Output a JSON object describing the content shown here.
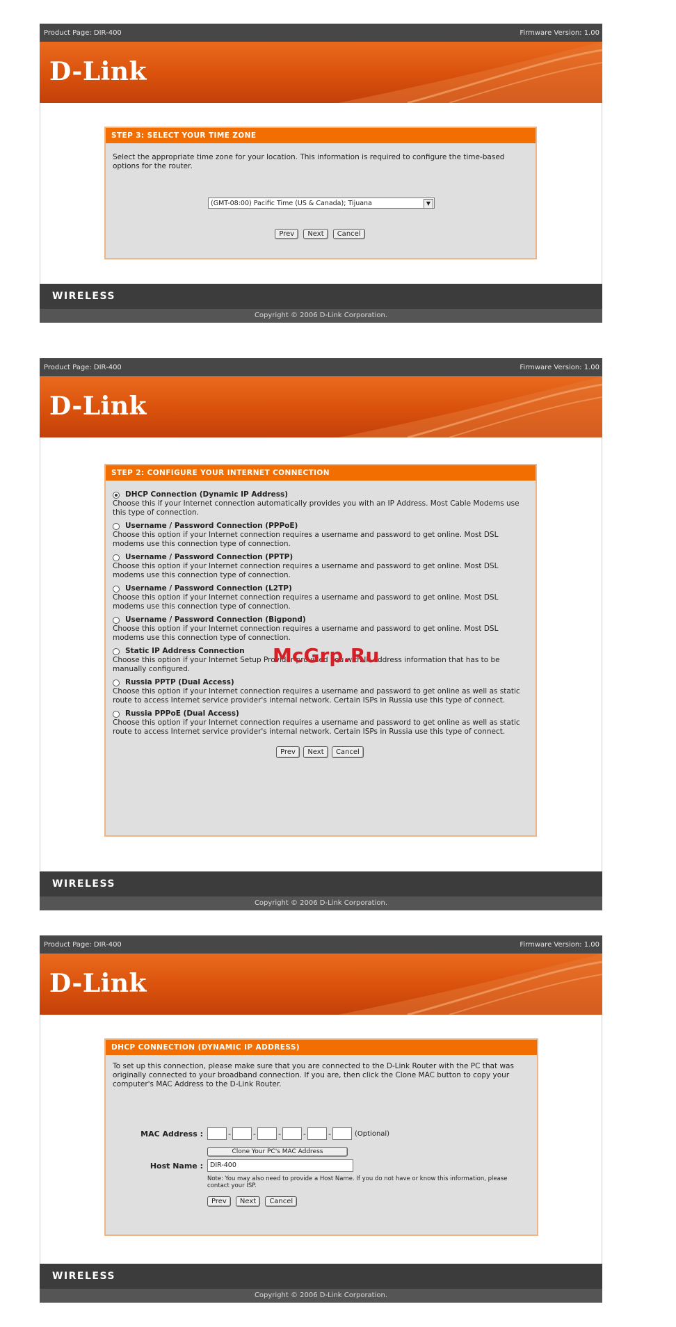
{
  "header": {
    "product": "Product Page: DIR-400",
    "firmware": "Firmware Version: 1.00",
    "logo": "D-Link"
  },
  "footer": {
    "wireless": "WIRELESS",
    "copyright": "Copyright © 2006 D-Link Corporation."
  },
  "colors": {
    "orange": "#f26e00",
    "dark": "#3c3c3c",
    "panel": "#dfdfdf"
  },
  "screen1": {
    "heading": "STEP 3: SELECT YOUR TIME ZONE",
    "description": "Select the appropriate time zone for your location. This information is required to configure the time-based options for the router.",
    "timezone": "(GMT-08:00) Pacific Time (US & Canada); Tijuana",
    "buttons": {
      "prev": "Prev",
      "next": "Next",
      "cancel": "Cancel"
    }
  },
  "screen2": {
    "heading": "STEP 2: CONFIGURE YOUR INTERNET CONNECTION",
    "options": [
      {
        "title": "DHCP Connection (Dynamic IP Address)",
        "desc": "Choose this if your Internet connection automatically provides you with an IP Address. Most Cable Modems use this type of connection."
      },
      {
        "title": "Username / Password Connection (PPPoE)",
        "desc": "Choose this option if your Internet connection requires a username and password to get online. Most DSL modems use this connection type of connection."
      },
      {
        "title": "Username / Password Connection (PPTP)",
        "desc": "Choose this option if your Internet connection requires a username and password to get online. Most DSL modems use this connection type of connection."
      },
      {
        "title": "Username / Password Connection (L2TP)",
        "desc": "Choose this option if your Internet connection requires a username and password to get online. Most DSL modems use this connection type of connection."
      },
      {
        "title": "Username / Password Connection (Bigpond)",
        "desc": "Choose this option if your Internet connection requires a username and password to get online. Most DSL modems use this connection type of connection."
      },
      {
        "title": "Static IP Address Connection",
        "desc": "Choose this option if your Internet Setup Provider provided you with IP Address information that has to be manually configured."
      },
      {
        "title": "Russia PPTP (Dual Access)",
        "desc": "Choose this option if your Internet connection requires a username and password to get online as well as static route to access Internet service provider's internal network. Certain ISPs in Russia use this type of connect."
      },
      {
        "title": "Russia PPPoE (Dual Access)",
        "desc": "Choose this option if your Internet connection requires a username and password to get online as well as static route to access Internet service provider's internal network. Certain ISPs in Russia use this type of connect."
      }
    ],
    "buttons": {
      "prev": "Prev",
      "next": "Next",
      "cancel": "Cancel"
    }
  },
  "screen3": {
    "heading": "DHCP CONNECTION (DYNAMIC IP ADDRESS)",
    "description": "To set up this connection, please make sure that you are connected to the D-Link Router with the PC that was originally connected to your broadband connection. If you are, then click the Clone MAC button to copy your computer's MAC Address to the D-Link Router.",
    "mac_label": "MAC Address :",
    "optional": "(Optional)",
    "clone_button": "Clone Your PC's MAC Address",
    "host_label": "Host Name :",
    "host_value": "DIR-400",
    "note": "Note: You may also need to provide a Host Name. If you do not have or know this information, please contact your ISP.",
    "buttons": {
      "prev": "Prev",
      "next": "Next",
      "cancel": "Cancel"
    }
  },
  "watermark": "McGrp.Ru"
}
